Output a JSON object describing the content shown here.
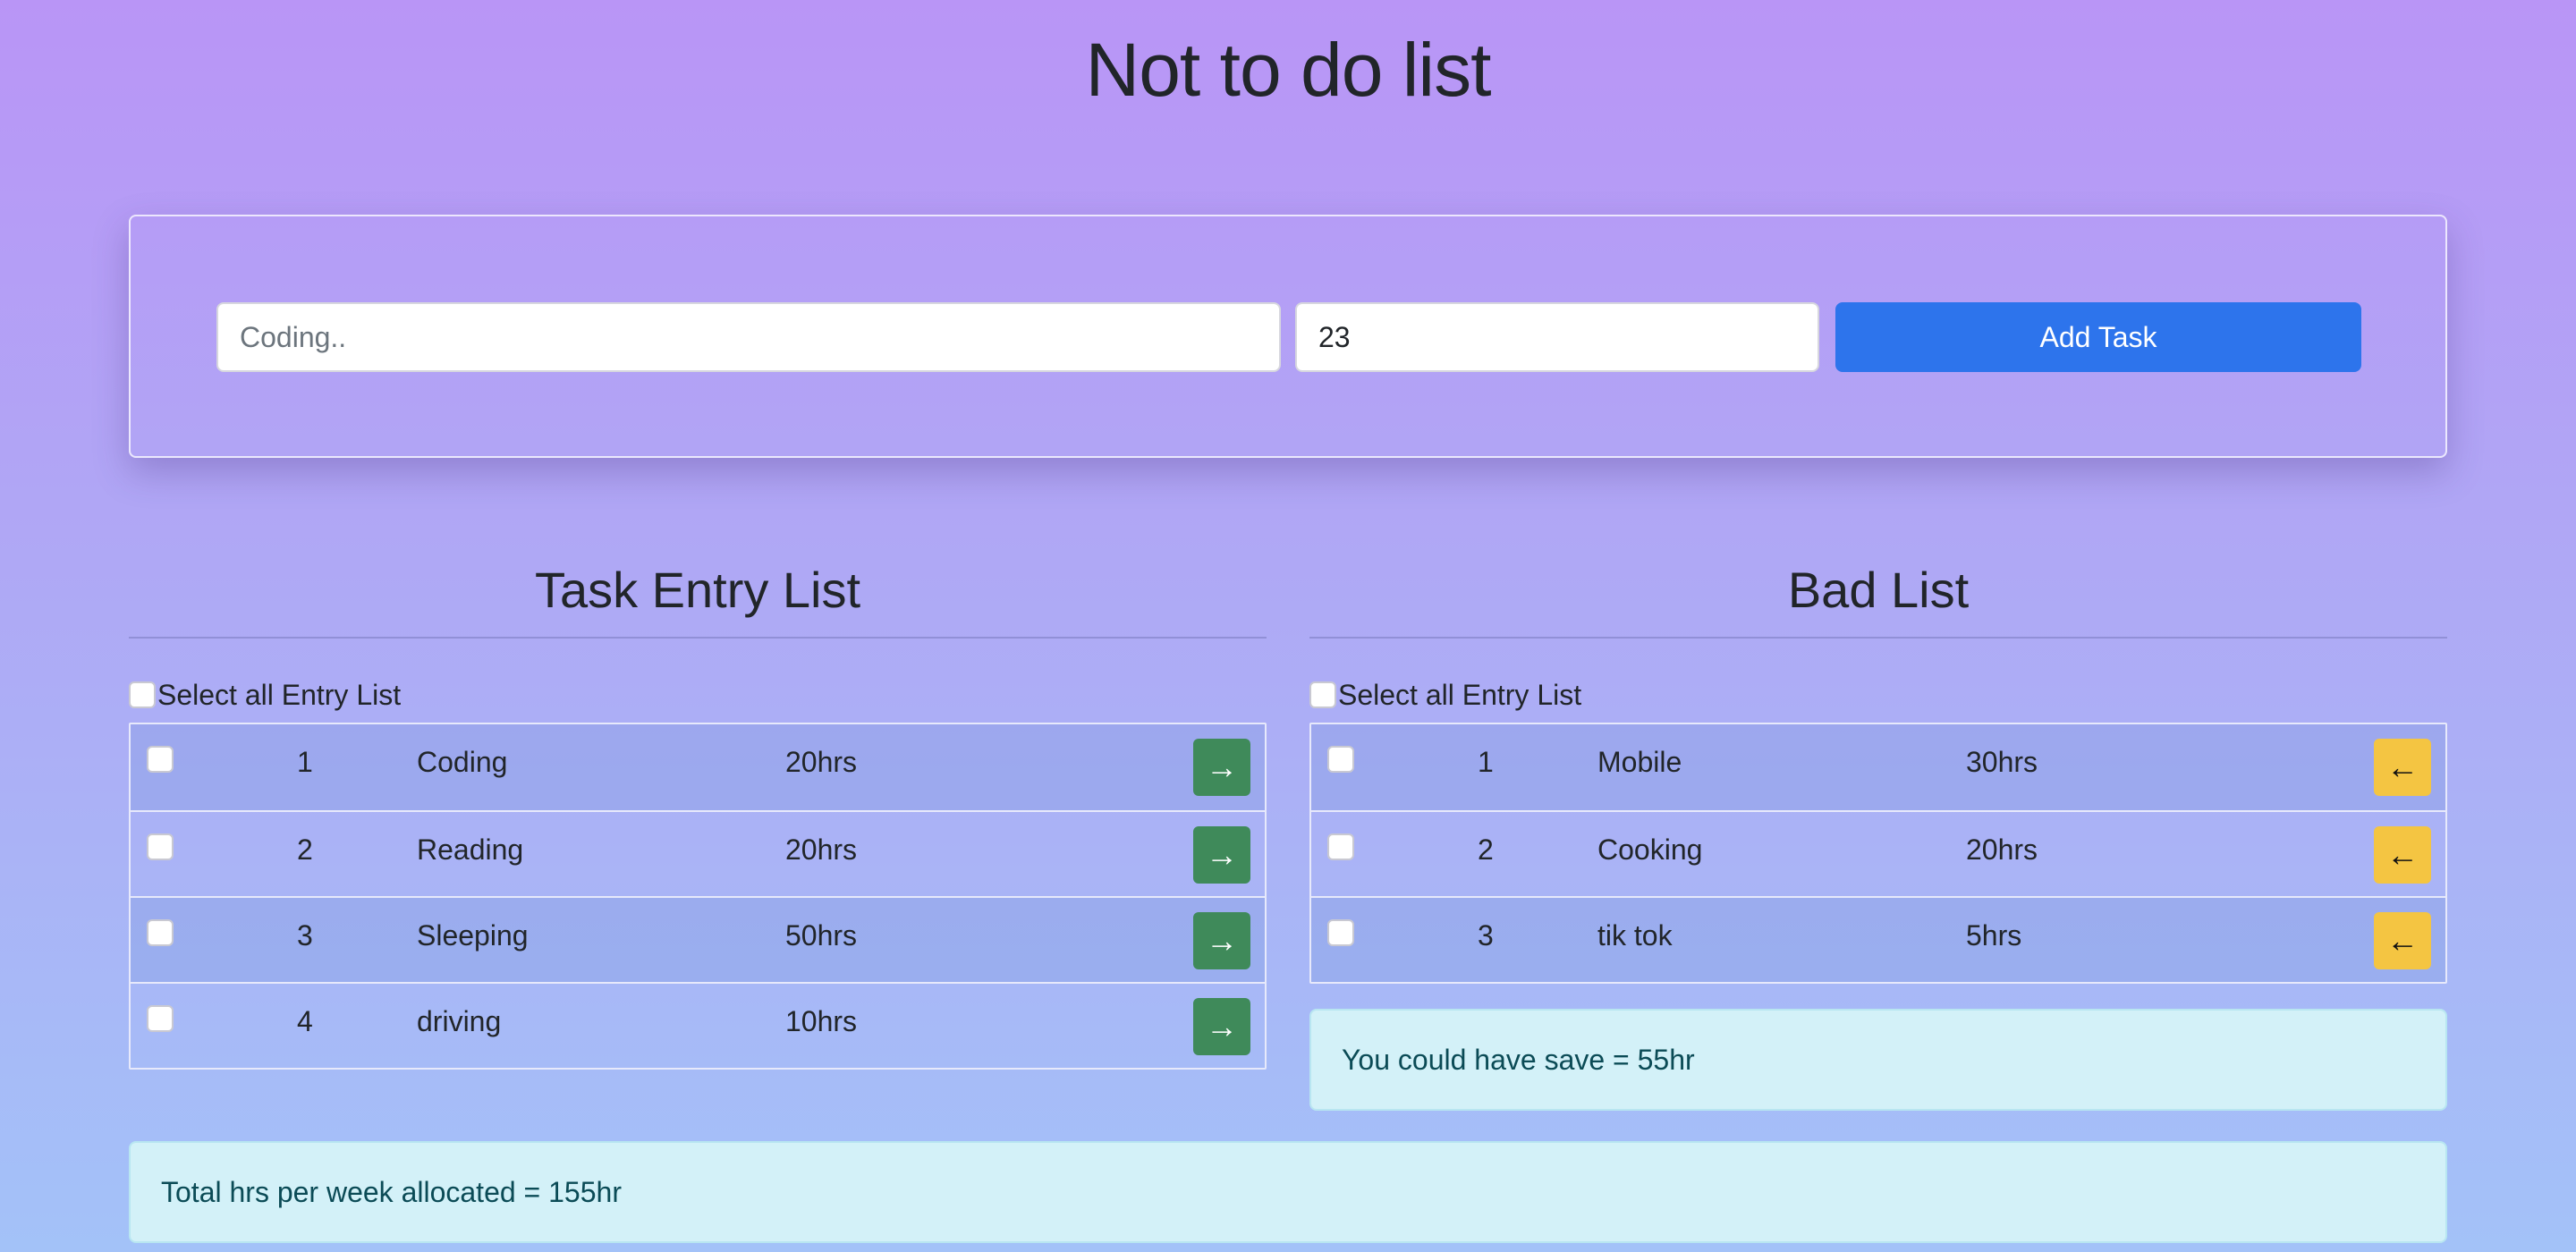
{
  "header": {
    "title": "Not to do list"
  },
  "form": {
    "task_placeholder": "Coding..",
    "hours_value": "23",
    "add_label": "Add Task"
  },
  "entry_list": {
    "title": "Task Entry List",
    "select_all_label": "Select all Entry List",
    "rows": [
      {
        "num": "1",
        "name": "Coding",
        "hrs": "20hrs",
        "action_icon": "→"
      },
      {
        "num": "2",
        "name": "Reading",
        "hrs": "20hrs",
        "action_icon": "→"
      },
      {
        "num": "3",
        "name": "Sleeping",
        "hrs": "50hrs",
        "action_icon": "→"
      },
      {
        "num": "4",
        "name": "driving",
        "hrs": "10hrs",
        "action_icon": "→"
      }
    ]
  },
  "bad_list": {
    "title": "Bad List",
    "select_all_label": "Select all Entry List",
    "rows": [
      {
        "num": "1",
        "name": "Mobile",
        "hrs": "30hrs",
        "action_icon": "←"
      },
      {
        "num": "2",
        "name": "Cooking",
        "hrs": "20hrs",
        "action_icon": "←"
      },
      {
        "num": "3",
        "name": "tik tok",
        "hrs": "5hrs",
        "action_icon": "←"
      }
    ],
    "saved_text": "You could have save = 55hr"
  },
  "footer": {
    "total_text": "Total hrs per week allocated = 155hr"
  },
  "colors": {
    "primary": "#2d74ec",
    "success": "#3f8a5a",
    "warning": "#f4c542",
    "info_bg": "#d3f1f8"
  }
}
